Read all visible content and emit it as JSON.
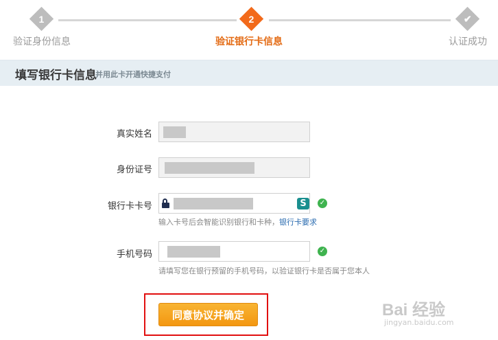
{
  "stepper": {
    "steps": [
      {
        "number": "1",
        "label": "验证身份信息",
        "state": "done"
      },
      {
        "number": "2",
        "label": "验证银行卡信息",
        "state": "active"
      },
      {
        "number": "",
        "label": "认证成功",
        "state": "pending",
        "icon": "check-icon"
      }
    ],
    "active_color": "#f26a1b"
  },
  "section": {
    "title": "填写银行卡信息",
    "subtitle": "并用此卡开通快捷支付"
  },
  "form": {
    "name_label": "真实姓名",
    "id_label": "身份证号",
    "card_label": "银行卡卡号",
    "card_hint": "输入卡号后会智能识别银行和卡种，",
    "card_hint_link": "银行卡要求",
    "bank_logo_icon": "bank-logo-icon",
    "phone_label": "手机号码",
    "phone_hint": "请填写您在银行预留的手机号码，以验证银行卡是否属于您本人"
  },
  "confirm_button": "同意协议并确定",
  "watermark": {
    "main": "Bai 经验",
    "sub": "jingyan.baidu.com"
  }
}
